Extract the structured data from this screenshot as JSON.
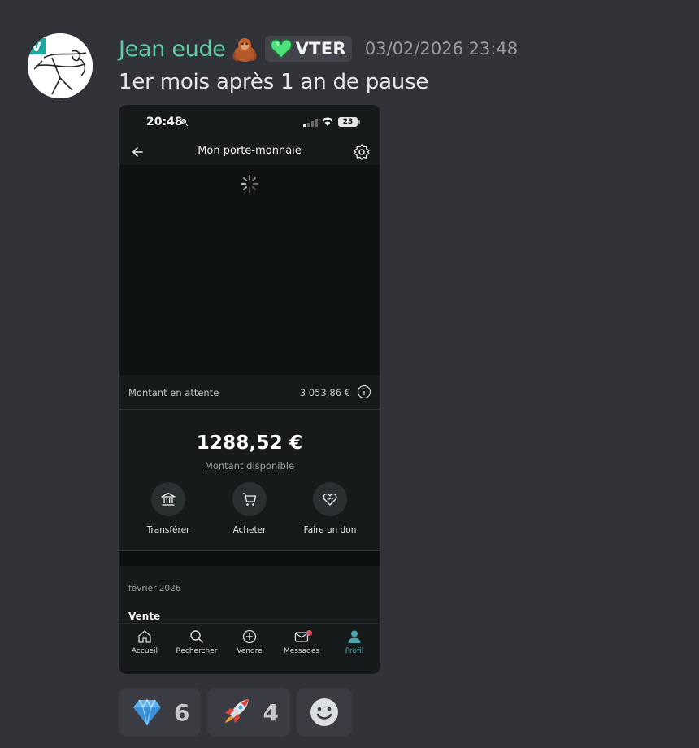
{
  "message": {
    "username": "Jean eude",
    "role_tag": "VTER",
    "timestamp": "03/02/2026 23:48",
    "text": "1er mois après 1 an de pause",
    "avatar_letter": "V"
  },
  "phone": {
    "status_time": "20:48",
    "battery": "23",
    "nav_title": "Mon porte-monnaie",
    "pending_label": "Montant en attente",
    "pending_value": "3 053,86 €",
    "balance_amount": "1288,52 €",
    "balance_label": "Montant disponible",
    "actions": [
      {
        "label": "Transférer",
        "icon": "bank-icon"
      },
      {
        "label": "Acheter",
        "icon": "cart-icon"
      },
      {
        "label": "Faire un don",
        "icon": "heart-hand-icon"
      }
    ],
    "month_label": "février 2026",
    "section_label": "Vente",
    "tabs": [
      {
        "label": "Accueil",
        "icon": "home-icon"
      },
      {
        "label": "Rechercher",
        "icon": "search-icon"
      },
      {
        "label": "Vendre",
        "icon": "plus-circle-icon"
      },
      {
        "label": "Messages",
        "icon": "mail-icon"
      },
      {
        "label": "Profil",
        "icon": "user-icon"
      }
    ],
    "accent_color": "#4aa3ad"
  },
  "reactions": [
    {
      "emoji": "gem-icon",
      "count": "6"
    },
    {
      "emoji": "rocket-icon",
      "count": "4"
    }
  ],
  "colors": {
    "background": "#323339",
    "username": "#5fcda4",
    "timestamp": "#9a9ca3"
  }
}
